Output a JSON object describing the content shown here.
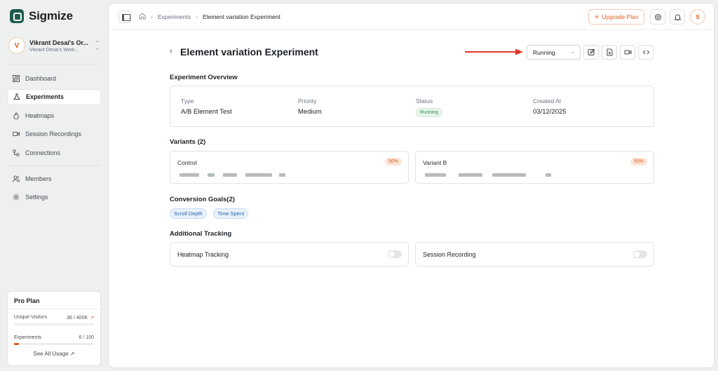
{
  "app": {
    "name": "Sigmize"
  },
  "workspace": {
    "initial": "V",
    "name": "Vikrant Desai's Or...",
    "subtitle": "Vikrant Desai's Work..."
  },
  "sidebar": {
    "items": [
      {
        "label": "Dashboard",
        "icon": "dashboard-icon"
      },
      {
        "label": "Experiments",
        "icon": "experiments-icon",
        "active": true
      },
      {
        "label": "Heatmaps",
        "icon": "heatmap-icon"
      },
      {
        "label": "Session Recordings",
        "icon": "video-icon"
      },
      {
        "label": "Connections",
        "icon": "connections-icon"
      }
    ],
    "items2": [
      {
        "label": "Members",
        "icon": "members-icon"
      },
      {
        "label": "Settings",
        "icon": "gear-icon"
      }
    ]
  },
  "plan": {
    "title": "Pro Plan",
    "visitors_label": "Unique Visitors",
    "visitors_value": "36 / 400K",
    "visitors_fraction": 0.0001,
    "experiments_label": "Experiments",
    "experiments_value": "6 / 100",
    "experiments_fraction": 0.06,
    "see_all": "See All Usage"
  },
  "breadcrumb": {
    "items": [
      "Experiments",
      "Element variation Experiment"
    ]
  },
  "topbar": {
    "upgrade_label": "Upgrade Plan",
    "user_initial": "S"
  },
  "page": {
    "title": "Element variation Experiment",
    "status_value": "Running"
  },
  "overview": {
    "title": "Experiment Overview",
    "type_label": "Type",
    "type_value": "A/B Element Test",
    "priority_label": "Priority",
    "priority_value": "Medium",
    "status_label": "Status",
    "status_value": "Running",
    "created_label": "Created At",
    "created_value": "03/12/2025"
  },
  "variants": {
    "title": "Variants (2)",
    "items": [
      {
        "name": "Control",
        "percent": "50%"
      },
      {
        "name": "Variant B",
        "percent": "50%"
      }
    ]
  },
  "goals": {
    "title": "Conversion Goals(2)",
    "items": [
      "Scroll Depth",
      "Time Spent"
    ]
  },
  "tracking": {
    "title": "Additional Tracking",
    "items": [
      {
        "label": "Heatmap Tracking",
        "enabled": false
      },
      {
        "label": "Session Recording",
        "enabled": false
      }
    ]
  },
  "colors": {
    "accent": "#e25a1c",
    "brand": "#1f5b4f",
    "arrow": "#e5352b",
    "success": "#2f8a49"
  }
}
